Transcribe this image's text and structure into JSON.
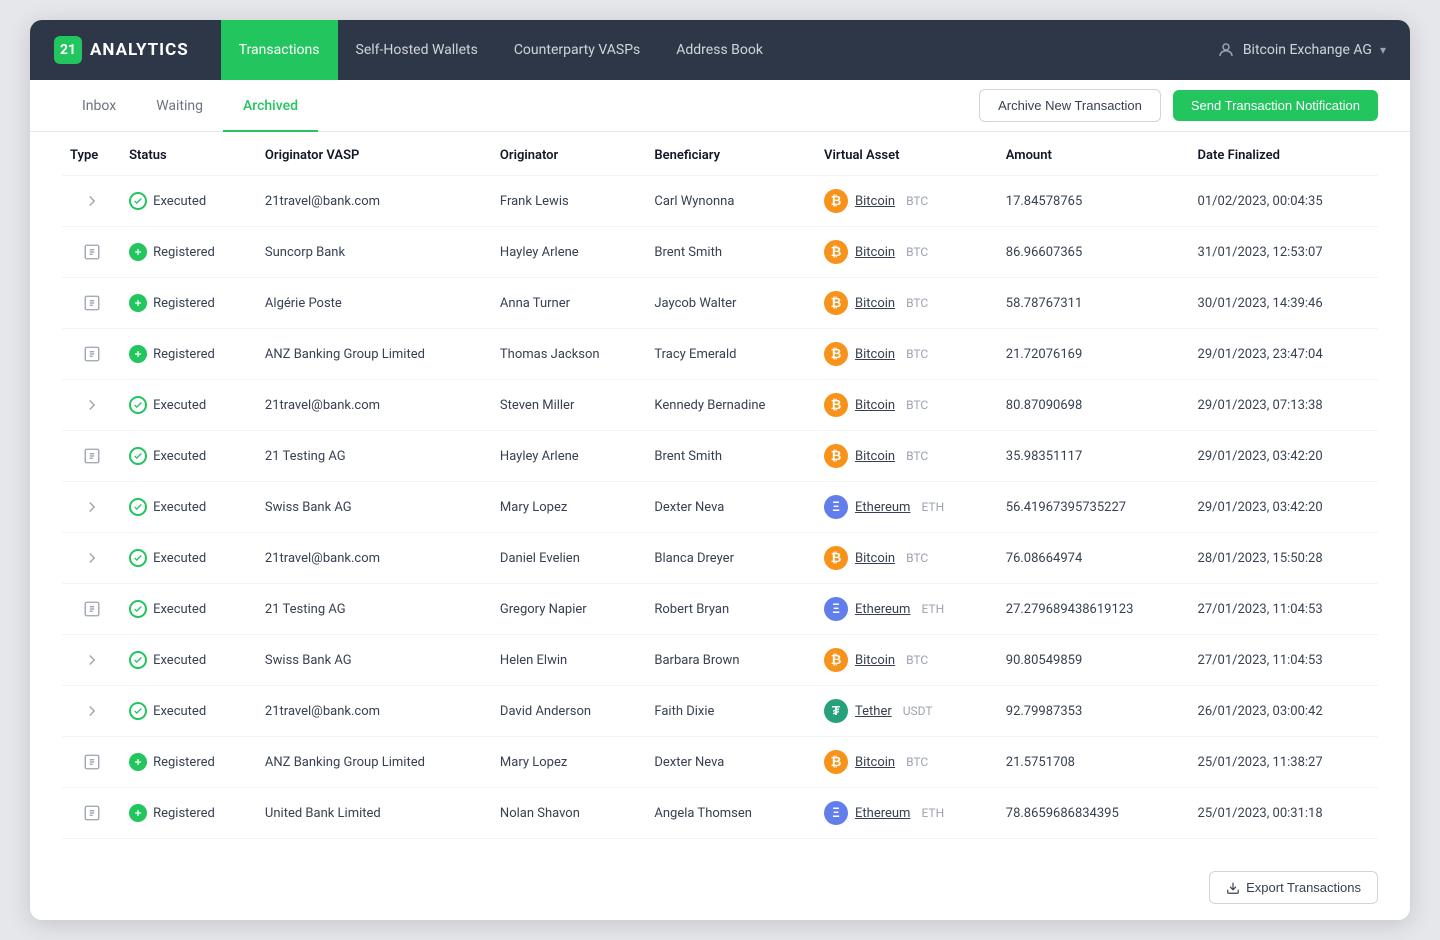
{
  "app": {
    "logo_number": "21",
    "logo_title": "ANALYTICS"
  },
  "nav": {
    "items": [
      {
        "id": "transactions",
        "label": "Transactions",
        "active": true
      },
      {
        "id": "self-hosted-wallets",
        "label": "Self-Hosted Wallets",
        "active": false
      },
      {
        "id": "counterparty-vasps",
        "label": "Counterparty VASPs",
        "active": false
      },
      {
        "id": "address-book",
        "label": "Address Book",
        "active": false
      }
    ],
    "user_label": "Bitcoin Exchange AG",
    "chevron": "▾"
  },
  "tabs": {
    "items": [
      {
        "id": "inbox",
        "label": "Inbox",
        "active": false
      },
      {
        "id": "waiting",
        "label": "Waiting",
        "active": false
      },
      {
        "id": "archived",
        "label": "Archived",
        "active": true
      }
    ],
    "archive_btn": "Archive New Transaction",
    "send_btn": "Send Transaction Notification"
  },
  "table": {
    "columns": [
      {
        "id": "type",
        "label": "Type"
      },
      {
        "id": "status",
        "label": "Status"
      },
      {
        "id": "originator_vasp",
        "label": "Originator VASP"
      },
      {
        "id": "originator",
        "label": "Originator"
      },
      {
        "id": "beneficiary",
        "label": "Beneficiary"
      },
      {
        "id": "virtual_asset",
        "label": "Virtual Asset"
      },
      {
        "id": "amount",
        "label": "Amount"
      },
      {
        "id": "date_finalized",
        "label": "Date Finalized"
      }
    ],
    "rows": [
      {
        "type": "send",
        "status": "Executed",
        "status_type": "executed",
        "originator_vasp": "21travel@bank.com",
        "originator": "Frank Lewis",
        "beneficiary": "Carl Wynonna",
        "asset_symbol": "BTC",
        "asset_name": "Bitcoin",
        "asset_ticker": "BTC",
        "amount": "17.84578765",
        "date": "01/02/2023, 00:04:35"
      },
      {
        "type": "receive",
        "status": "Registered",
        "status_type": "registered",
        "originator_vasp": "Suncorp Bank",
        "originator": "Hayley Arlene",
        "beneficiary": "Brent Smith",
        "asset_symbol": "BTC",
        "asset_name": "Bitcoin",
        "asset_ticker": "BTC",
        "amount": "86.96607365",
        "date": "31/01/2023, 12:53:07"
      },
      {
        "type": "receive",
        "status": "Registered",
        "status_type": "registered",
        "originator_vasp": "Algérie Poste",
        "originator": "Anna Turner",
        "beneficiary": "Jaycob Walter",
        "asset_symbol": "BTC",
        "asset_name": "Bitcoin",
        "asset_ticker": "BTC",
        "amount": "58.78767311",
        "date": "30/01/2023, 14:39:46"
      },
      {
        "type": "receive",
        "status": "Registered",
        "status_type": "registered",
        "originator_vasp": "ANZ Banking Group Limited",
        "originator": "Thomas Jackson",
        "beneficiary": "Tracy Emerald",
        "asset_symbol": "BTC",
        "asset_name": "Bitcoin",
        "asset_ticker": "BTC",
        "amount": "21.72076169",
        "date": "29/01/2023, 23:47:04"
      },
      {
        "type": "send",
        "status": "Executed",
        "status_type": "executed",
        "originator_vasp": "21travel@bank.com",
        "originator": "Steven Miller",
        "beneficiary": "Kennedy Bernadine",
        "asset_symbol": "BTC",
        "asset_name": "Bitcoin",
        "asset_ticker": "BTC",
        "amount": "80.87090698",
        "date": "29/01/2023, 07:13:38"
      },
      {
        "type": "receive",
        "status": "Executed",
        "status_type": "executed",
        "originator_vasp": "21 Testing AG",
        "originator": "Hayley Arlene",
        "beneficiary": "Brent Smith",
        "asset_symbol": "BTC",
        "asset_name": "Bitcoin",
        "asset_ticker": "BTC",
        "amount": "35.98351117",
        "date": "29/01/2023, 03:42:20"
      },
      {
        "type": "send",
        "status": "Executed",
        "status_type": "executed",
        "originator_vasp": "Swiss Bank AG",
        "originator": "Mary Lopez",
        "beneficiary": "Dexter Neva",
        "asset_symbol": "ETH",
        "asset_name": "Ethereum",
        "asset_ticker": "ETH",
        "amount": "56.41967395735227",
        "date": "29/01/2023, 03:42:20"
      },
      {
        "type": "send",
        "status": "Executed",
        "status_type": "executed",
        "originator_vasp": "21travel@bank.com",
        "originator": "Daniel Evelien",
        "beneficiary": "Blanca Dreyer",
        "asset_symbol": "BTC",
        "asset_name": "Bitcoin",
        "asset_ticker": "BTC",
        "amount": "76.08664974",
        "date": "28/01/2023, 15:50:28"
      },
      {
        "type": "receive",
        "status": "Executed",
        "status_type": "executed",
        "originator_vasp": "21 Testing AG",
        "originator": "Gregory Napier",
        "beneficiary": "Robert Bryan",
        "asset_symbol": "ETH",
        "asset_name": "Ethereum",
        "asset_ticker": "ETH",
        "amount": "27.279689438619123",
        "date": "27/01/2023, 11:04:53"
      },
      {
        "type": "send",
        "status": "Executed",
        "status_type": "executed",
        "originator_vasp": "Swiss Bank AG",
        "originator": "Helen Elwin",
        "beneficiary": "Barbara Brown",
        "asset_symbol": "BTC",
        "asset_name": "Bitcoin",
        "asset_ticker": "BTC",
        "amount": "90.80549859",
        "date": "27/01/2023, 11:04:53"
      },
      {
        "type": "send",
        "status": "Executed",
        "status_type": "executed",
        "originator_vasp": "21travel@bank.com",
        "originator": "David Anderson",
        "beneficiary": "Faith Dixie",
        "asset_symbol": "USDT",
        "asset_name": "Tether",
        "asset_ticker": "USDT",
        "amount": "92.79987353",
        "date": "26/01/2023, 03:00:42"
      },
      {
        "type": "receive",
        "status": "Registered",
        "status_type": "registered",
        "originator_vasp": "ANZ Banking Group Limited",
        "originator": "Mary Lopez",
        "beneficiary": "Dexter Neva",
        "asset_symbol": "BTC",
        "asset_name": "Bitcoin",
        "asset_ticker": "BTC",
        "amount": "21.5751708",
        "date": "25/01/2023, 11:38:27"
      },
      {
        "type": "receive",
        "status": "Registered",
        "status_type": "registered",
        "originator_vasp": "United Bank Limited",
        "originator": "Nolan Shavon",
        "beneficiary": "Angela Thomsen",
        "asset_symbol": "ETH",
        "asset_name": "Ethereum",
        "asset_ticker": "ETH",
        "amount": "78.8659686834395",
        "date": "25/01/2023, 00:31:18"
      }
    ]
  },
  "footer": {
    "export_btn": "Export Transactions"
  }
}
